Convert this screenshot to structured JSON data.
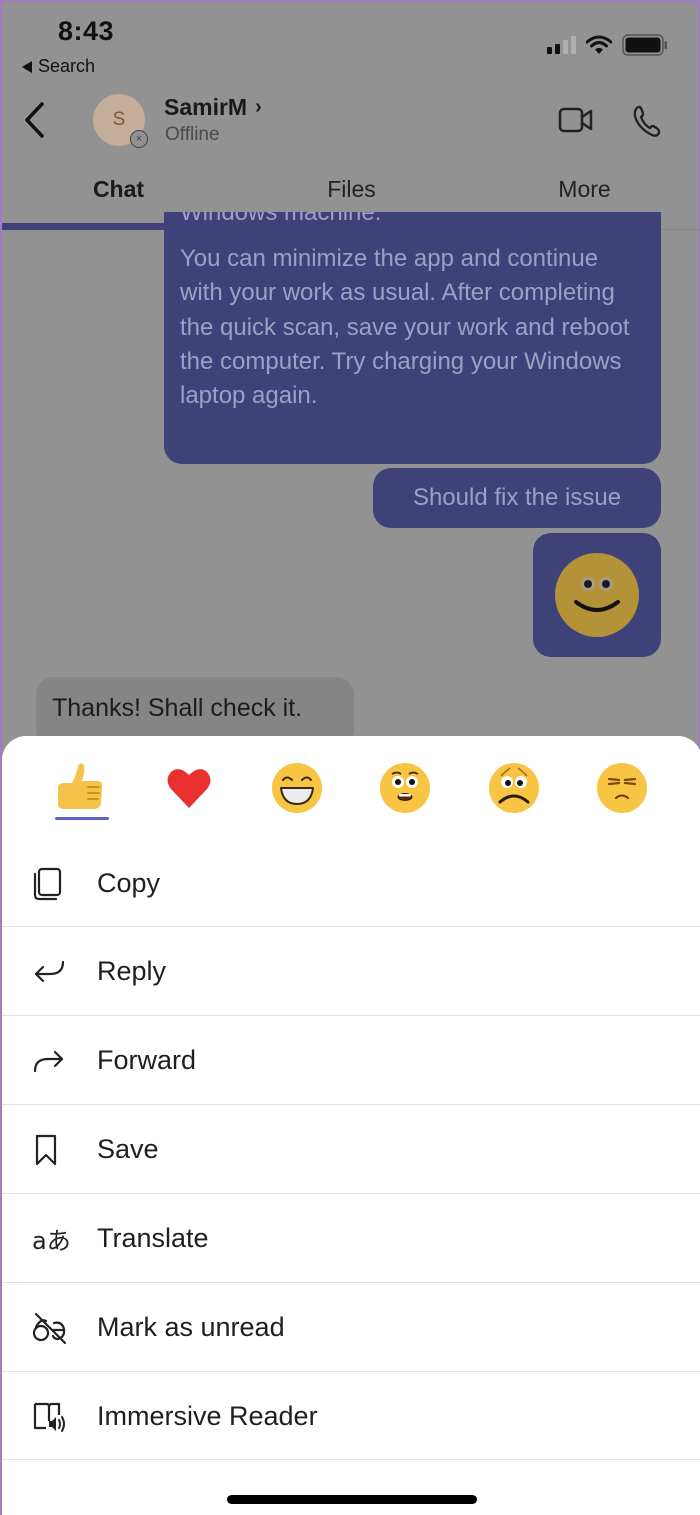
{
  "status_bar": {
    "time": "8:43",
    "back_app": "Search",
    "icons": [
      "cellular-signal-icon",
      "wifi-icon",
      "battery-icon"
    ]
  },
  "header": {
    "avatar_initial": "S",
    "contact_name": "SamirM",
    "presence": "Offline",
    "icons": [
      "back-chevron-icon",
      "video-call-icon",
      "phone-call-icon"
    ]
  },
  "tabs": [
    {
      "label": "Chat",
      "active": true
    },
    {
      "label": "Files",
      "active": false
    },
    {
      "label": "More",
      "active": false
    }
  ],
  "messages": {
    "long_cut_line": "Windows machine.",
    "long_body": "You can minimize the app and continue with your work as usual. After completing the quick scan, save your work and reboot the computer. Try charging your Windows laptop again.",
    "short": "Should fix the issue",
    "emoji": "smile-emoji",
    "reply": "Thanks! Shall check it."
  },
  "reactions": [
    {
      "name": "like",
      "selected": true
    },
    {
      "name": "heart",
      "selected": false
    },
    {
      "name": "laugh",
      "selected": false
    },
    {
      "name": "surprised",
      "selected": false
    },
    {
      "name": "sad",
      "selected": false
    },
    {
      "name": "angry",
      "selected": false
    }
  ],
  "menu": [
    {
      "label": "Copy",
      "icon": "copy-icon"
    },
    {
      "label": "Reply",
      "icon": "reply-icon"
    },
    {
      "label": "Forward",
      "icon": "forward-icon"
    },
    {
      "label": "Save",
      "icon": "bookmark-icon"
    },
    {
      "label": "Translate",
      "icon": "translate-icon"
    },
    {
      "label": "Mark as unread",
      "icon": "mark-unread-icon"
    },
    {
      "label": "Immersive Reader",
      "icon": "immersive-reader-icon"
    }
  ],
  "colors": {
    "accent": "#5b5fc7",
    "my_bubble_dimmed": "#3f4279",
    "overlay_bg": "#929292",
    "heart": "#e8312f",
    "emoji_yellow": "#f7c443"
  }
}
